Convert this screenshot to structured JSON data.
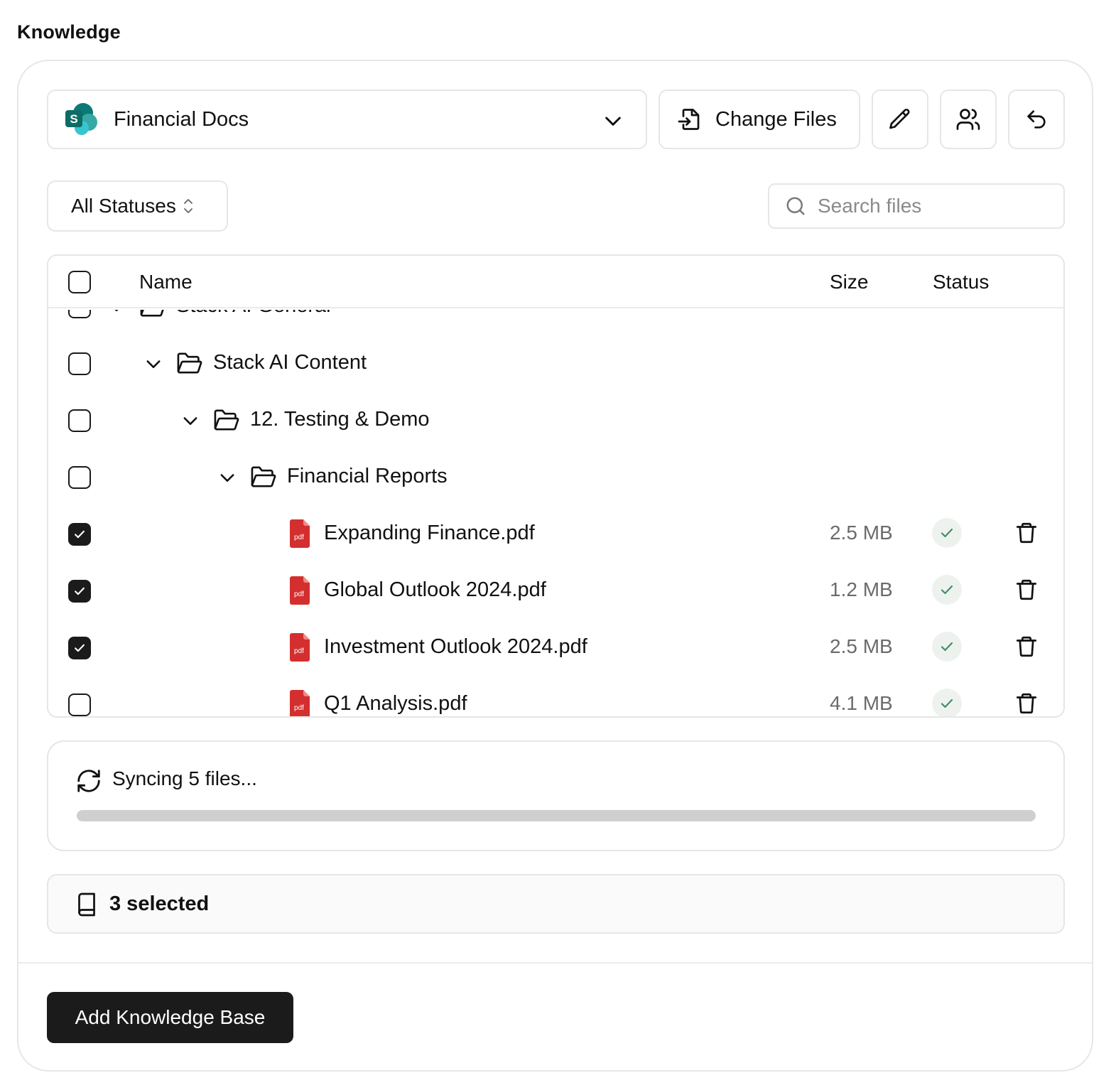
{
  "page": {
    "title": "Knowledge"
  },
  "source": {
    "name": "Financial Docs",
    "logo_letter": "S",
    "icon": "sharepoint-logo"
  },
  "toolbar": {
    "change_files_label": "Change Files",
    "edit_icon": "pencil-icon",
    "users_icon": "users-icon",
    "undo_icon": "undo-icon"
  },
  "filter": {
    "status_label": "All Statuses"
  },
  "search": {
    "placeholder": "Search files",
    "value": ""
  },
  "table": {
    "columns": {
      "name": "Name",
      "size": "Size",
      "status": "Status"
    },
    "rows": [
      {
        "type": "folder",
        "name": "Stack AI General",
        "depth": 0,
        "checked": false,
        "expanded": true
      },
      {
        "type": "folder",
        "name": "Stack AI Content",
        "depth": 1,
        "checked": false,
        "expanded": true
      },
      {
        "type": "folder",
        "name": "12. Testing & Demo",
        "depth": 2,
        "checked": false,
        "expanded": true
      },
      {
        "type": "folder",
        "name": "Financial Reports",
        "depth": 3,
        "checked": false,
        "expanded": true
      },
      {
        "type": "file",
        "name": "Expanding Finance.pdf",
        "size": "2.5 MB",
        "status": "indexed",
        "checked": true,
        "file_badge": "pdf"
      },
      {
        "type": "file",
        "name": "Global Outlook 2024.pdf",
        "size": "1.2 MB",
        "status": "indexed",
        "checked": true,
        "file_badge": "pdf"
      },
      {
        "type": "file",
        "name": "Investment Outlook 2024.pdf",
        "size": "2.5 MB",
        "status": "indexed",
        "checked": true,
        "file_badge": "pdf"
      },
      {
        "type": "file",
        "name": "Q1 Analysis.pdf",
        "size": "4.1 MB",
        "status": "indexed",
        "checked": false,
        "file_badge": "pdf"
      }
    ]
  },
  "sync": {
    "label": "Syncing 5 files...",
    "progress": 1.0
  },
  "selection": {
    "label": "3 selected"
  },
  "footer": {
    "primary_label": "Add Knowledge Base"
  },
  "colors": {
    "primary": "#1b1b1b",
    "pdf_red": "#d32f2f",
    "success_check": "#3f8f67",
    "sharepoint_teal": "#1a7f7a"
  }
}
